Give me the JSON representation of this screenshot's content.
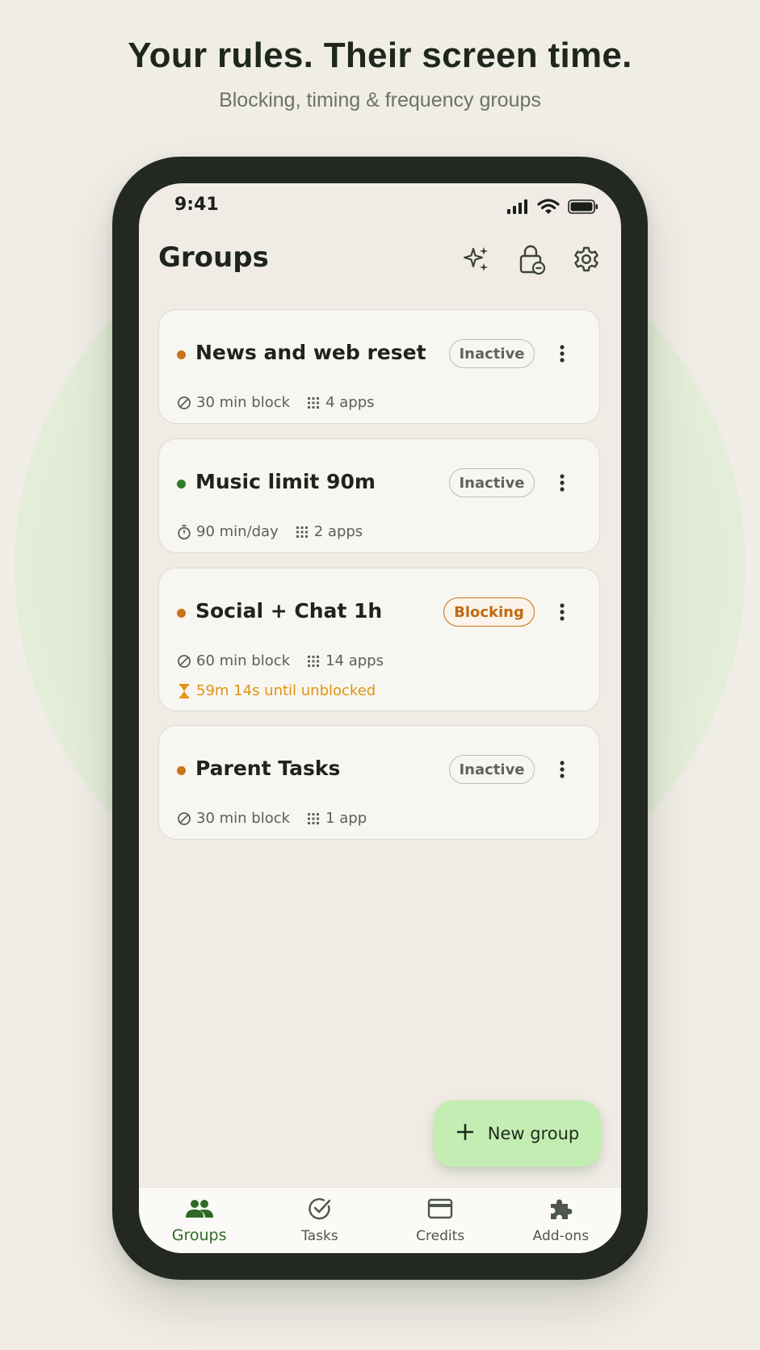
{
  "marketing": {
    "headline": "Your rules. Their screen time.",
    "subheadline": "Blocking, timing & frequency groups"
  },
  "status_bar": {
    "time": "9:41"
  },
  "header": {
    "title": "Groups",
    "icons": [
      "sparkle-icon",
      "lock-icon",
      "gear-icon"
    ]
  },
  "groups": [
    {
      "name": "News and web reset",
      "status": "Inactive",
      "dot_color": "#c8741a",
      "rule_icon": "block-icon",
      "rule": "30 min block",
      "apps": "4 apps"
    },
    {
      "name": "Music limit 90m",
      "status": "Inactive",
      "dot_color": "#2f7d2a",
      "rule_icon": "timer-icon",
      "rule": "90 min/day",
      "apps": "2 apps"
    },
    {
      "name": "Social + Chat 1h",
      "status": "Blocking",
      "dot_color": "#c8741a",
      "rule_icon": "block-icon",
      "rule": "60 min block",
      "apps": "14 apps",
      "countdown": "59m 14s until unblocked"
    },
    {
      "name": "Parent Tasks",
      "status": "Inactive",
      "dot_color": "#c8741a",
      "rule_icon": "block-icon",
      "rule": "30 min block",
      "apps": "1 app"
    }
  ],
  "fab": {
    "label": "New group"
  },
  "bottom_nav": [
    {
      "label": "Groups",
      "icon": "people-icon",
      "active": true
    },
    {
      "label": "Tasks",
      "icon": "check-circle-icon",
      "active": false
    },
    {
      "label": "Credits",
      "icon": "card-icon",
      "active": false
    },
    {
      "label": "Add-ons",
      "icon": "puzzle-icon",
      "active": false
    }
  ],
  "colors": {
    "accent_green": "#2d6b25",
    "blocking_orange": "#c06a10",
    "countdown_orange": "#e0940f",
    "fab_green": "#c4edb3"
  }
}
